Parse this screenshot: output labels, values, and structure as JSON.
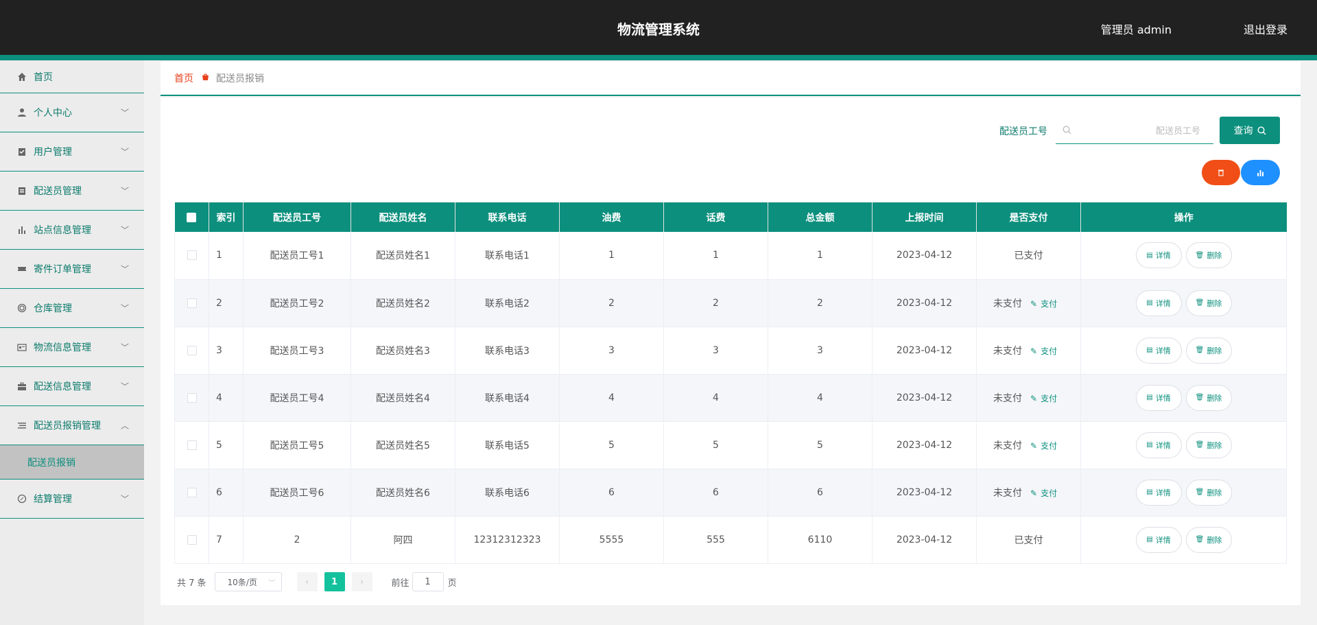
{
  "header": {
    "title": "物流管理系统",
    "admin": "管理员 admin",
    "logout": "退出登录"
  },
  "sidebar": {
    "items": [
      {
        "label": "首页",
        "icon": "home-icon"
      },
      {
        "label": "个人中心",
        "icon": "user-icon"
      },
      {
        "label": "用户管理",
        "icon": "clipboard-check-icon"
      },
      {
        "label": "配送员管理",
        "icon": "clipboard-icon"
      },
      {
        "label": "站点信息管理",
        "icon": "bar-chart-icon"
      },
      {
        "label": "寄件订单管理",
        "icon": "ticket-icon"
      },
      {
        "label": "仓库管理",
        "icon": "circle-icon"
      },
      {
        "label": "物流信息管理",
        "icon": "id-card-icon"
      },
      {
        "label": "配送信息管理",
        "icon": "briefcase-icon"
      },
      {
        "label": "配送员报销管理",
        "icon": "list-icon"
      },
      {
        "label": "结算管理",
        "icon": "compass-icon"
      }
    ],
    "submenu": {
      "label": "配送员报销"
    }
  },
  "breadcrumb": {
    "home": "首页",
    "current": "配送员报销"
  },
  "search": {
    "label": "配送员工号",
    "placeholder": "配送员工号",
    "value": "",
    "button": "查询"
  },
  "table": {
    "headers": [
      "索引",
      "配送员工号",
      "配送员姓名",
      "联系电话",
      "油费",
      "话费",
      "总金额",
      "上报时间",
      "是否支付",
      "操作"
    ],
    "rows": [
      {
        "index": "1",
        "worker_id": "配送员工号1",
        "name": "配送员姓名1",
        "phone": "联系电话1",
        "fuel": "1",
        "phone_fee": "1",
        "total": "1",
        "date": "2023-04-12",
        "paid": "已支付",
        "pay_link": ""
      },
      {
        "index": "2",
        "worker_id": "配送员工号2",
        "name": "配送员姓名2",
        "phone": "联系电话2",
        "fuel": "2",
        "phone_fee": "2",
        "total": "2",
        "date": "2023-04-12",
        "paid": "未支付",
        "pay_link": "支付"
      },
      {
        "index": "3",
        "worker_id": "配送员工号3",
        "name": "配送员姓名3",
        "phone": "联系电话3",
        "fuel": "3",
        "phone_fee": "3",
        "total": "3",
        "date": "2023-04-12",
        "paid": "未支付",
        "pay_link": "支付"
      },
      {
        "index": "4",
        "worker_id": "配送员工号4",
        "name": "配送员姓名4",
        "phone": "联系电话4",
        "fuel": "4",
        "phone_fee": "4",
        "total": "4",
        "date": "2023-04-12",
        "paid": "未支付",
        "pay_link": "支付"
      },
      {
        "index": "5",
        "worker_id": "配送员工号5",
        "name": "配送员姓名5",
        "phone": "联系电话5",
        "fuel": "5",
        "phone_fee": "5",
        "total": "5",
        "date": "2023-04-12",
        "paid": "未支付",
        "pay_link": "支付"
      },
      {
        "index": "6",
        "worker_id": "配送员工号6",
        "name": "配送员姓名6",
        "phone": "联系电话6",
        "fuel": "6",
        "phone_fee": "6",
        "total": "6",
        "date": "2023-04-12",
        "paid": "未支付",
        "pay_link": "支付"
      },
      {
        "index": "7",
        "worker_id": "2",
        "name": "阿四",
        "phone": "12312312323",
        "fuel": "5555",
        "phone_fee": "555",
        "total": "6110",
        "date": "2023-04-12",
        "paid": "已支付",
        "pay_link": ""
      }
    ],
    "actions": {
      "detail": "详情",
      "delete": "删除"
    }
  },
  "pagination": {
    "total": "共 7 条",
    "page_size": "10条/页",
    "current_page": "1",
    "goto_label": "前往",
    "goto_value": "1",
    "page_suffix": "页"
  },
  "colors": {
    "accent": "#0c8f7d",
    "header_bg": "#212121",
    "danger": "#f04e16",
    "info": "#1e90ff",
    "page_active": "#13c29c"
  }
}
